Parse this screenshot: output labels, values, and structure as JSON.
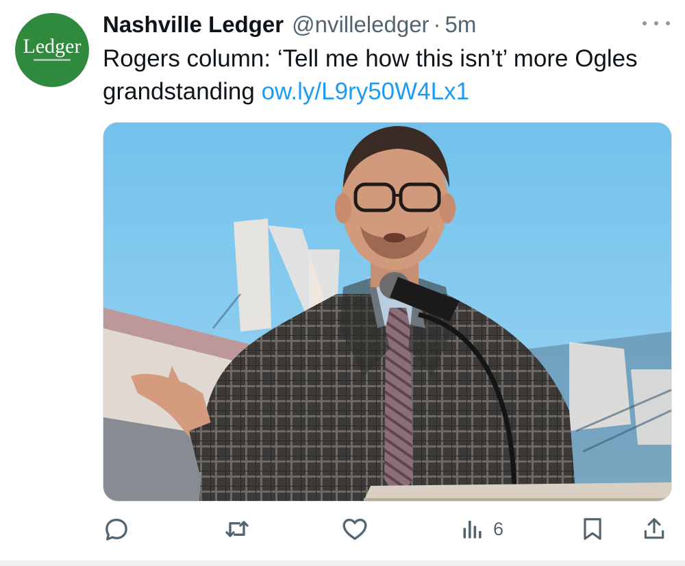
{
  "tweet": {
    "author_name": "Nashville Ledger",
    "author_handle": "@nvilleledger",
    "separator": "·",
    "time": "5m",
    "avatar_text": "Ledger",
    "text": "Rogers column: ‘Tell me how this isn’t’ more Ogles grandstanding ",
    "link": "ow.ly/L9ry50W4Lx1",
    "more_icon": "more-icon",
    "media_alt": "Man in glasses and plaid coat speaking at a podium microphone outdoors"
  },
  "actions": {
    "reply_icon": "reply-icon",
    "retweet_icon": "retweet-icon",
    "like_icon": "like-icon",
    "views_icon": "views-icon",
    "views_count": "6",
    "bookmark_icon": "bookmark-icon",
    "share_icon": "share-icon"
  },
  "colors": {
    "link": "#1d9bf0",
    "secondary_text": "#536471",
    "avatar_bg": "#2f8a3e"
  }
}
